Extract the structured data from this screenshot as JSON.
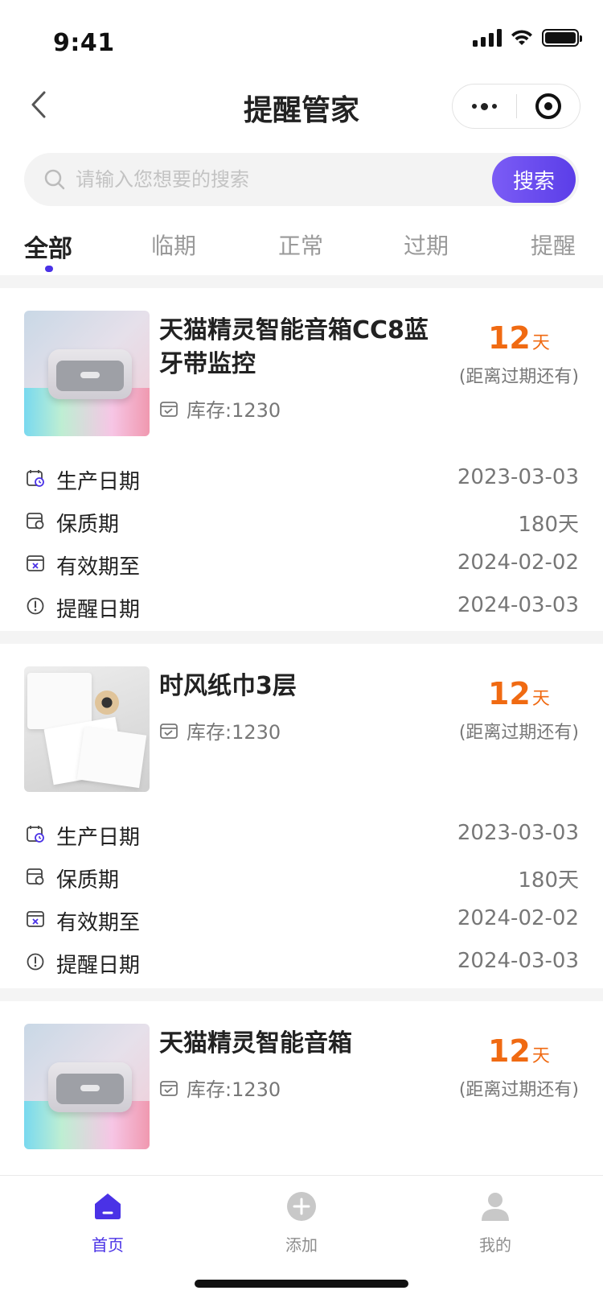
{
  "status": {
    "time": "9:41"
  },
  "nav": {
    "title": "提醒管家"
  },
  "search": {
    "placeholder": "请输入您想要的搜索",
    "button_label": "搜索"
  },
  "tabs": [
    {
      "label": "全部",
      "active": true
    },
    {
      "label": "临期",
      "active": false
    },
    {
      "label": "正常",
      "active": false
    },
    {
      "label": "过期",
      "active": false
    },
    {
      "label": "提醒",
      "active": false
    }
  ],
  "accent_color": "#4a32e6",
  "warning_color": "#f06a12",
  "products": [
    {
      "name": "天猫精灵智能音箱CC8蓝牙带监控",
      "stock": "库存:1230",
      "days": "12",
      "days_unit": "天",
      "days_caption": "(距离过期还有)",
      "rows": [
        {
          "icon": "calendar-clock-icon",
          "label": "生产日期",
          "value": "2023-03-03"
        },
        {
          "icon": "shelf-life-icon",
          "label": "保质期",
          "value": "180天"
        },
        {
          "icon": "calendar-x-icon",
          "label": "有效期至",
          "value": "2024-02-02"
        },
        {
          "icon": "alert-circle-icon",
          "label": "提醒日期",
          "value": "2024-03-03"
        }
      ]
    },
    {
      "name": "时风纸巾3层",
      "stock": "库存:1230",
      "days": "12",
      "days_unit": "天",
      "days_caption": "(距离过期还有)",
      "rows": [
        {
          "icon": "calendar-clock-icon",
          "label": "生产日期",
          "value": "2023-03-03"
        },
        {
          "icon": "shelf-life-icon",
          "label": "保质期",
          "value": "180天"
        },
        {
          "icon": "calendar-x-icon",
          "label": "有效期至",
          "value": "2024-02-02"
        },
        {
          "icon": "alert-circle-icon",
          "label": "提醒日期",
          "value": "2024-03-03"
        }
      ]
    },
    {
      "name": "天猫精灵智能音箱",
      "stock": "库存:1230",
      "days": "12",
      "days_unit": "天",
      "days_caption": "(距离过期还有)"
    }
  ],
  "tabbar": [
    {
      "label": "首页",
      "icon": "home-icon",
      "active": true
    },
    {
      "label": "添加",
      "icon": "add-circle-icon",
      "active": false
    },
    {
      "label": "我的",
      "icon": "user-icon",
      "active": false
    }
  ]
}
